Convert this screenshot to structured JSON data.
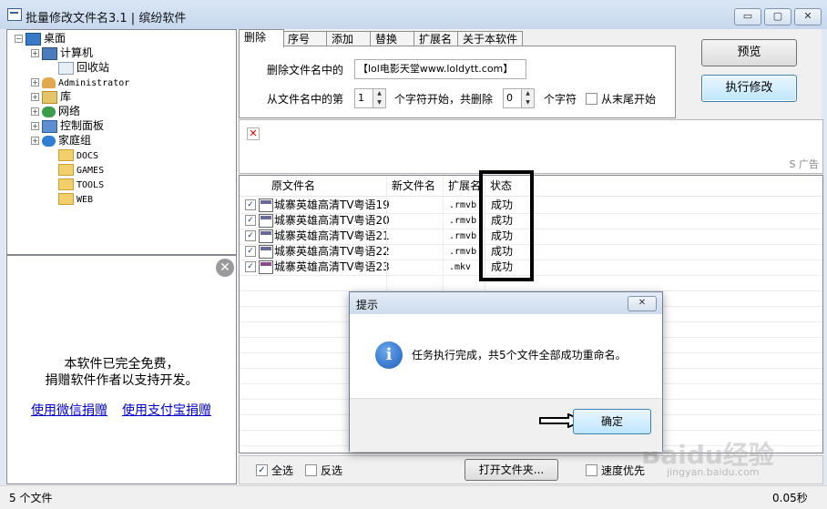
{
  "window": {
    "title": "批量修改文件名3.1 | 缤纷软件",
    "min_glyph": "▭",
    "max_glyph": "▢",
    "close_glyph": "✕"
  },
  "tree": {
    "items": [
      {
        "label": "桌面",
        "expander": "−",
        "icon": "desktop-icon",
        "mono": false
      },
      {
        "label": "计算机",
        "expander": "+",
        "icon": "computer-icon",
        "mono": false
      },
      {
        "label": "回收站",
        "expander": "",
        "icon": "recycle-bin-icon",
        "mono": false
      },
      {
        "label": "Administrator",
        "expander": "+",
        "icon": "user-icon",
        "mono": true
      },
      {
        "label": "库",
        "expander": "+",
        "icon": "library-icon",
        "mono": false
      },
      {
        "label": "网络",
        "expander": "+",
        "icon": "network-icon",
        "mono": false
      },
      {
        "label": "控制面板",
        "expander": "+",
        "icon": "control-panel-icon",
        "mono": false
      },
      {
        "label": "家庭组",
        "expander": "+",
        "icon": "homegroup-icon",
        "mono": false
      },
      {
        "label": "DOCS",
        "expander": "",
        "icon": "folder-icon",
        "mono": true
      },
      {
        "label": "GAMES",
        "expander": "",
        "icon": "folder-icon",
        "mono": true
      },
      {
        "label": "TOOLS",
        "expander": "",
        "icon": "folder-icon",
        "mono": true
      },
      {
        "label": "WEB",
        "expander": "",
        "icon": "folder-icon",
        "mono": true
      }
    ]
  },
  "promo": {
    "close_glyph": "✕",
    "line1": "本软件已完全免费，",
    "line2": "捐赠软件作者以支持开发。",
    "wechat_link": "使用微信捐赠",
    "alipay_link": "使用支付宝捐赠"
  },
  "tabs": [
    "删除",
    "序号",
    "添加",
    "替换",
    "扩展名",
    "关于本软件"
  ],
  "delete_tab": {
    "label_remove_text": "删除文件名中的",
    "remove_text_value": "【lol电影天堂www.loldytt.com】",
    "label_from_pos": "从文件名中的第",
    "start_pos": "1",
    "label_mid": "个字符开始，共删除",
    "count": "0",
    "label_unit": "个字符",
    "from_end_label": "从末尾开始",
    "spin_up": "▲",
    "spin_down": "▼"
  },
  "buttons": {
    "preview": "预览",
    "execute": "执行修改",
    "open_folder": "打开文件夹...",
    "ok": "确定"
  },
  "ad": {
    "broken_glyph": "✕",
    "tag": "S 广告"
  },
  "file_list": {
    "columns": [
      "原文件名",
      "新文件名",
      "扩展名",
      "状态"
    ],
    "check_glyph": "✓",
    "rows": [
      {
        "name": "城寨英雄高清TV粤语19",
        "newname": "",
        "ext": ".rmvb",
        "status": "成功",
        "type": "rmvb"
      },
      {
        "name": "城寨英雄高清TV粤语20",
        "newname": "",
        "ext": ".rmvb",
        "status": "成功",
        "type": "rmvb"
      },
      {
        "name": "城寨英雄高清TV粤语21",
        "newname": "",
        "ext": ".rmvb",
        "status": "成功",
        "type": "rmvb"
      },
      {
        "name": "城寨英雄高清TV粤语22",
        "newname": "",
        "ext": ".rmvb",
        "status": "成功",
        "type": "rmvb"
      },
      {
        "name": "城寨英雄高清TV粤语23",
        "newname": "",
        "ext": ".mkv",
        "status": "成功",
        "type": "mkv"
      }
    ]
  },
  "bottom": {
    "select_all": "全选",
    "invert": "反选",
    "speed_first": "速度优先",
    "check_glyph": "✓"
  },
  "status": {
    "count": "5 个文件",
    "time": "0.05秒"
  },
  "dialog": {
    "title": "提示",
    "close_glyph": "✕",
    "info_glyph": "i",
    "message": "任务执行完成，共5个文件全部成功重命名。"
  },
  "watermark": {
    "brand": "Baidu经验",
    "url": "jingyan.baidu.com"
  }
}
